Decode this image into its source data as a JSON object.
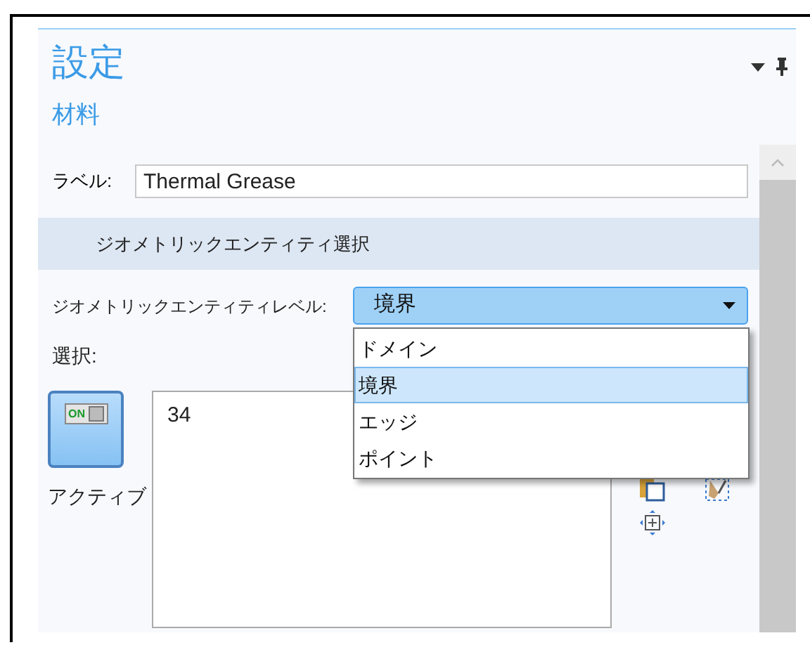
{
  "panel": {
    "title": "設定",
    "subtitle": "材料"
  },
  "label_field": {
    "label": "ラベル:",
    "value": "Thermal Grease"
  },
  "section": {
    "title": "ジオメトリックエンティティ選択"
  },
  "level_select": {
    "label": "ジオメトリックエンティティレベル:",
    "value": "境界",
    "expanded": true,
    "options": [
      {
        "label": "ドメイン",
        "selected": false
      },
      {
        "label": "境界",
        "selected": true
      },
      {
        "label": "エッジ",
        "selected": false
      },
      {
        "label": "ポイント",
        "selected": false
      }
    ]
  },
  "selection": {
    "label": "選択:",
    "toggle": {
      "on": true,
      "text": "ON",
      "label": "アクティブ"
    },
    "items": [
      "34"
    ]
  }
}
